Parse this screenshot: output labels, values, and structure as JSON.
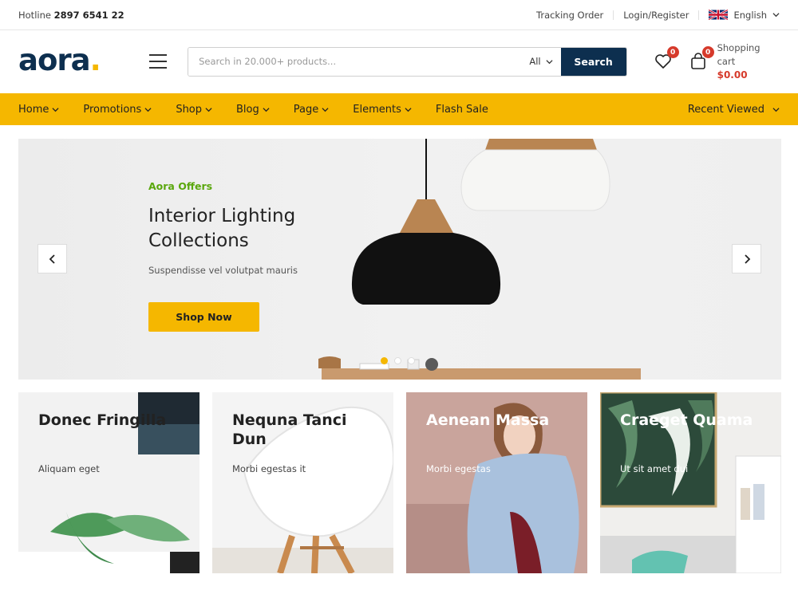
{
  "topbar": {
    "hotline_label": "Hotline",
    "hotline_number": "2897 6541 22",
    "tracking": "Tracking Order",
    "login": "Login/Register",
    "language": "English"
  },
  "header": {
    "logo": "aora",
    "logo_dot": ".",
    "search_placeholder": "Search in 20.000+ products...",
    "search_category": "All",
    "search_button": "Search",
    "wishlist_count": "0",
    "cart_count": "0",
    "cart_label": "Shopping cart",
    "cart_total": "$0.00"
  },
  "nav": {
    "items": [
      {
        "label": "Home"
      },
      {
        "label": "Promotions"
      },
      {
        "label": "Shop"
      },
      {
        "label": "Blog"
      },
      {
        "label": "Page"
      },
      {
        "label": "Elements"
      },
      {
        "label": "Flash Sale"
      }
    ],
    "recent": "Recent Viewed"
  },
  "hero": {
    "kicker": "Aora Offers",
    "title": "Interior Lighting Collections",
    "subtitle": "Suspendisse vel volutpat mauris",
    "button": "Shop Now",
    "slides": 3,
    "active_slide": 1
  },
  "banners": [
    {
      "title": "Donec Fringilla",
      "subtitle": "Aliquam eget"
    },
    {
      "title": "Nequna Tanci Dun",
      "subtitle": "Morbi egestas it"
    },
    {
      "title": "Aenean Massa",
      "subtitle": "Morbi egestas"
    },
    {
      "title": "Craeget Quama",
      "subtitle": "Ut sit amet dui"
    }
  ],
  "colors": {
    "accent": "#f5b700",
    "brand": "#0d2f4f",
    "badge": "#d63a2b",
    "kicker": "#5aa70d"
  }
}
